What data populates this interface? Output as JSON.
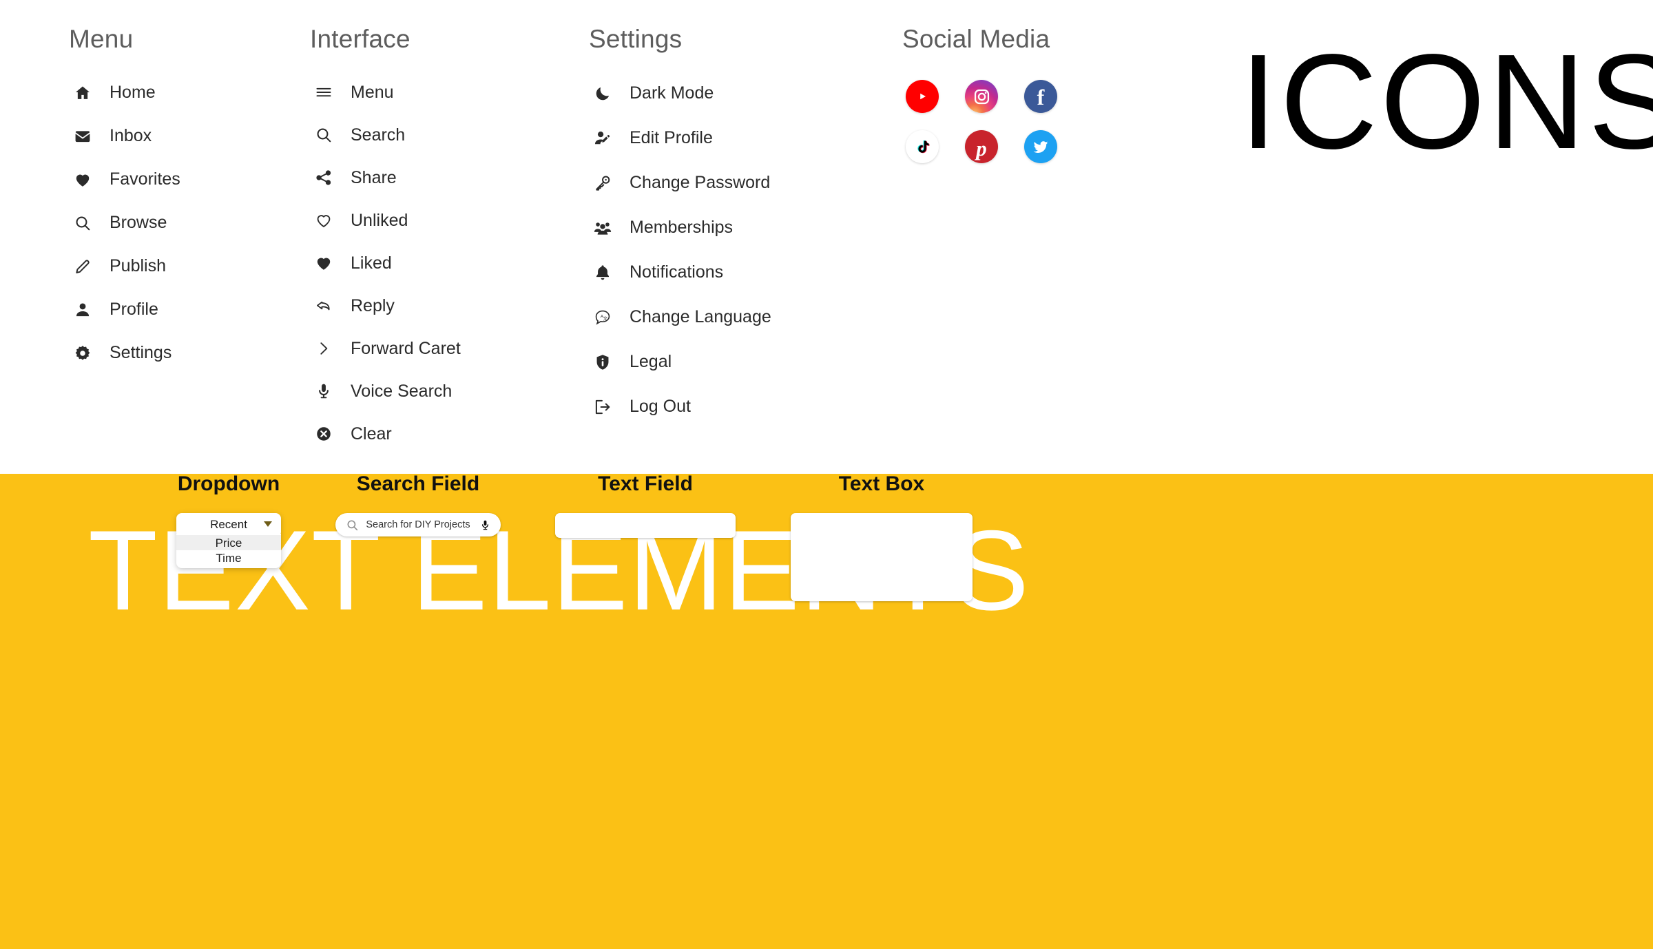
{
  "sections": {
    "icons_heading": "ICONS",
    "text_elements_heading": "TEXT ELEMENTS"
  },
  "colors": {
    "yellow_band": "#FBC115",
    "heading_gray": "#5D5D5D",
    "icon_black": "#2B2B2B",
    "youtube": "#FF0000",
    "facebook": "#3B5998",
    "pinterest": "#C8232C",
    "twitter": "#1DA1F2",
    "tiktok": "#FFFFFF",
    "instagram_gradient": "#D6249F"
  },
  "menu": {
    "title": "Menu",
    "items": [
      {
        "label": "Home",
        "icon": "home-icon"
      },
      {
        "label": "Inbox",
        "icon": "envelope-icon"
      },
      {
        "label": "Favorites",
        "icon": "heart-filled-icon"
      },
      {
        "label": "Browse",
        "icon": "search-icon"
      },
      {
        "label": "Publish",
        "icon": "pencil-icon"
      },
      {
        "label": "Profile",
        "icon": "person-icon"
      },
      {
        "label": "Settings",
        "icon": "gear-icon"
      }
    ]
  },
  "interface": {
    "title": "Interface",
    "items": [
      {
        "label": "Menu",
        "icon": "hamburger-icon"
      },
      {
        "label": "Search",
        "icon": "search-icon"
      },
      {
        "label": "Share",
        "icon": "share-icon"
      },
      {
        "label": "Unliked",
        "icon": "heart-outline-icon"
      },
      {
        "label": "Liked",
        "icon": "heart-filled-icon"
      },
      {
        "label": "Reply",
        "icon": "reply-arrow-icon"
      },
      {
        "label": "Forward Caret",
        "icon": "chevron-right-icon"
      },
      {
        "label": "Voice Search",
        "icon": "microphone-icon"
      },
      {
        "label": "Clear",
        "icon": "close-circle-icon"
      }
    ]
  },
  "settings": {
    "title": "Settings",
    "items": [
      {
        "label": "Dark Mode",
        "icon": "moon-icon"
      },
      {
        "label": "Edit Profile",
        "icon": "person-edit-icon"
      },
      {
        "label": "Change Password",
        "icon": "key-icon"
      },
      {
        "label": "Memberships",
        "icon": "people-group-icon"
      },
      {
        "label": "Notifications",
        "icon": "bell-icon"
      },
      {
        "label": "Change Language",
        "icon": "translate-bubble-icon"
      },
      {
        "label": "Legal",
        "icon": "shield-info-icon"
      },
      {
        "label": "Log Out",
        "icon": "logout-icon"
      }
    ]
  },
  "social": {
    "title": "Social Media",
    "items": [
      {
        "name": "youtube",
        "icon": "youtube-icon"
      },
      {
        "name": "instagram",
        "icon": "instagram-icon"
      },
      {
        "name": "facebook",
        "icon": "facebook-icon"
      },
      {
        "name": "tiktok",
        "icon": "tiktok-icon"
      },
      {
        "name": "pinterest",
        "icon": "pinterest-icon"
      },
      {
        "name": "twitter",
        "icon": "twitter-icon"
      }
    ]
  },
  "text_elements": {
    "dropdown": {
      "label": "Dropdown",
      "selected": "Recent",
      "options": [
        "Price",
        "Time"
      ],
      "highlighted_option": "Price"
    },
    "search_field": {
      "label": "Search Field",
      "placeholder": "Search for DIY Projects",
      "value": "",
      "left_icon": "search-icon",
      "right_icon": "microphone-icon"
    },
    "text_field": {
      "label": "Text Field",
      "value": "",
      "placeholder": ""
    },
    "text_box": {
      "label": "Text Box",
      "value": "",
      "placeholder": ""
    }
  }
}
